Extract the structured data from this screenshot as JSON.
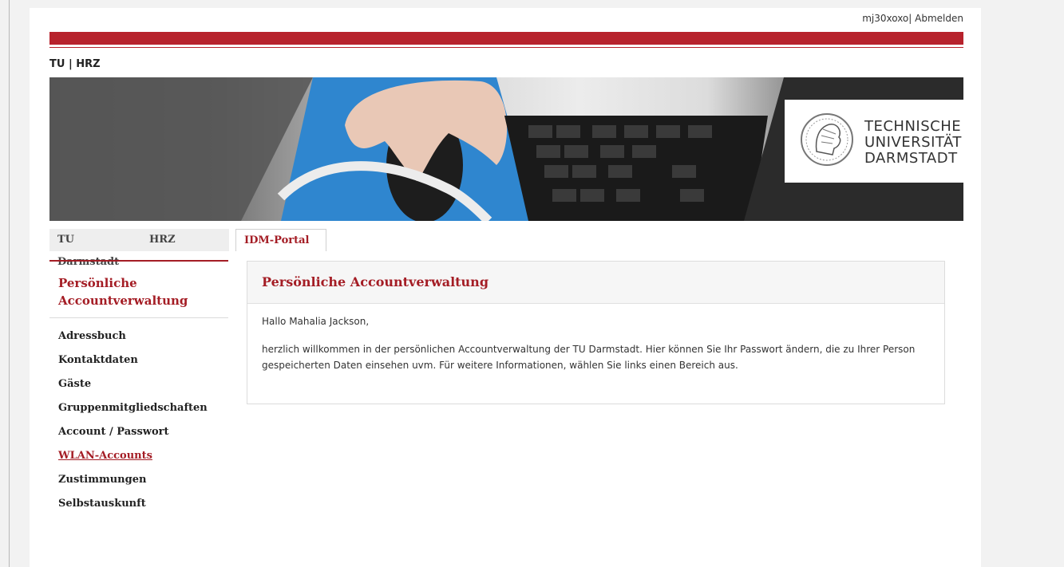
{
  "header": {
    "username": "mj30xoxo",
    "separator": "|",
    "logout_label": "Abmelden",
    "brand": "TU | HRZ",
    "brand_color": "#b7222c"
  },
  "hero": {
    "logo_line1": "TECHNISCHE",
    "logo_line2": "UNIVERSITÄT",
    "logo_line3": "DARMSTADT"
  },
  "tabs": [
    {
      "label": "TU Darmstadt"
    },
    {
      "label": "HRZ"
    },
    {
      "label": "IDM-Portal"
    }
  ],
  "sidebar": {
    "title": "Persönliche Accountverwaltung",
    "items": [
      {
        "label": "Adressbuch"
      },
      {
        "label": "Kontaktdaten"
      },
      {
        "label": "Gäste"
      },
      {
        "label": "Gruppenmitgliedschaften"
      },
      {
        "label": "Account / Passwort"
      },
      {
        "label": "WLAN-Accounts"
      },
      {
        "label": "Zustimmungen"
      },
      {
        "label": "Selbstauskunft"
      }
    ]
  },
  "main": {
    "title": "Persönliche Accountverwaltung",
    "greeting": "Hallo Mahalia Jackson,",
    "text": "herzlich willkommen in der persönlichen Accountverwaltung der TU Darmstadt. Hier können Sie Ihr Passwort ändern, die zu Ihrer Person gespeicherten Daten einsehen uvm. Für weitere Informationen, wählen Sie links einen Bereich aus."
  }
}
